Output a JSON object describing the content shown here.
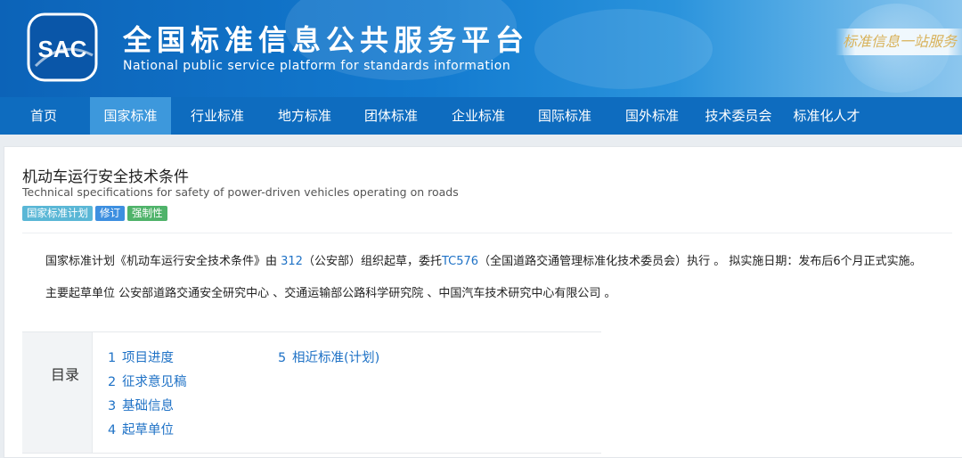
{
  "header": {
    "title_cn": "全国标准信息公共服务平台",
    "title_en": "National public service platform  for standards information",
    "logo_text": "SAC",
    "slogan": "标准信息一站服务"
  },
  "nav": {
    "items": [
      {
        "label": "首页"
      },
      {
        "label": "国家标准",
        "active": true
      },
      {
        "label": "行业标准"
      },
      {
        "label": "地方标准"
      },
      {
        "label": "团体标准"
      },
      {
        "label": "企业标准"
      },
      {
        "label": "国际标准"
      },
      {
        "label": "国外标准"
      },
      {
        "label": "技术委员会"
      },
      {
        "label": "标准化人才"
      }
    ]
  },
  "standard": {
    "title_cn": "机动车运行安全技术条件",
    "title_en": "Technical specifications for safety of power-driven vehicles operating on roads",
    "tags": [
      {
        "label": "国家标准计划",
        "color": "#5ab7d6"
      },
      {
        "label": "修订",
        "color": "#3d8fe0"
      },
      {
        "label": "强制性",
        "color": "#4fb36a"
      }
    ]
  },
  "description": {
    "part1": "国家标准计划《机动车运行安全技术条件》由 ",
    "org_code": "312",
    "part2": "（公安部）组织起草，委托",
    "tc_code": "TC576",
    "part3": "（全国道路交通管理标准化技术委员会）执行 。 拟实施日期：发布后6个月正式实施。"
  },
  "drafting": {
    "text": "主要起草单位 公安部道路交通安全研究中心 、交通运输部公路科学研究院 、中国汽车技术研究中心有限公司 。"
  },
  "toc": {
    "label": "目录",
    "items": [
      {
        "num": "1",
        "label": "项目进度"
      },
      {
        "num": "2",
        "label": "征求意见稿"
      },
      {
        "num": "3",
        "label": "基础信息"
      },
      {
        "num": "4",
        "label": "起草单位"
      },
      {
        "num": "5",
        "label": "相近标准(计划)"
      }
    ]
  }
}
